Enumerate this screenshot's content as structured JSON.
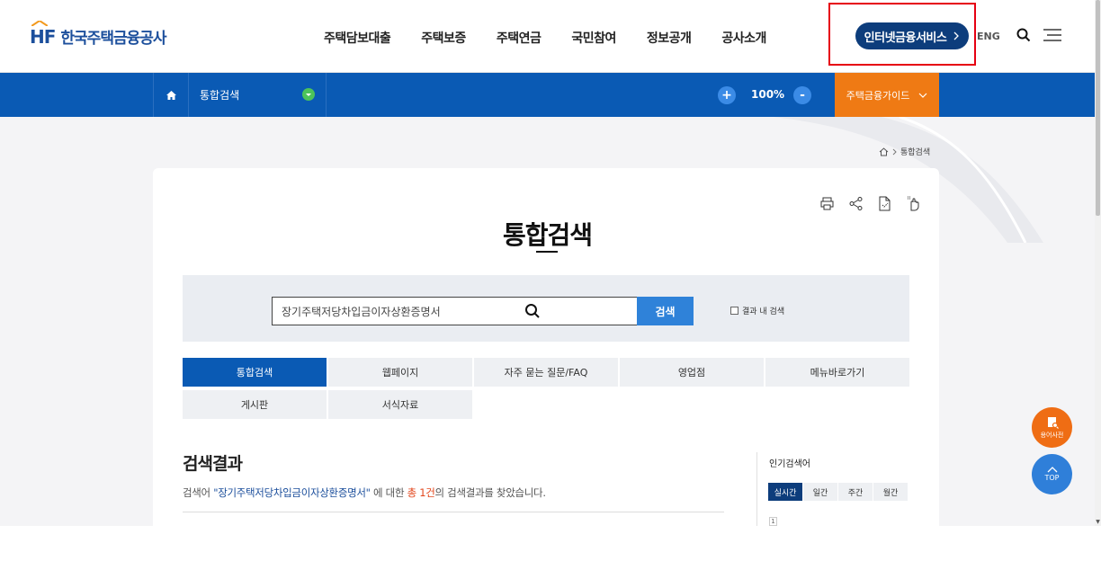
{
  "header": {
    "logo_mark": "HF",
    "logo_text": "한국주택금융공사",
    "gnb": [
      "주택담보대출",
      "주택보증",
      "주택연금",
      "국민참여",
      "정보공개",
      "공사소개"
    ],
    "internet_service": "인터넷금융서비스",
    "eng": "ENG"
  },
  "subbar": {
    "location": "통합검색",
    "zoom": "100%",
    "zoom_plus": "+",
    "zoom_minus": "-",
    "guide": "주택금융가이드"
  },
  "breadcrumb": {
    "current": "통합검색"
  },
  "page": {
    "title": "통합검색"
  },
  "search": {
    "value": "장기주택저당차입금이자상환증명서",
    "button": "검색",
    "inner_search": "결과 내 검색"
  },
  "tabs": [
    {
      "label": "통합검색",
      "active": true
    },
    {
      "label": "웹페이지"
    },
    {
      "label": "자주 묻는 질문/FAQ"
    },
    {
      "label": "영업점"
    },
    {
      "label": "메뉴바로가기"
    },
    {
      "label": "게시판"
    },
    {
      "label": "서식자료"
    }
  ],
  "results": {
    "title": "검색결과",
    "desc_prefix": "검색어 ",
    "query_quoted": "\"장기주택저당차입금이자상환증명서\"",
    "desc_mid": " 에 대한 ",
    "count": "총 1건",
    "desc_suffix": "의 검색결과를 찾았습니다."
  },
  "popular": {
    "title": "인기검색어",
    "tabs": [
      "실시간",
      "일간",
      "주간",
      "월간"
    ],
    "first_rank": "1"
  },
  "fabs": {
    "dict": "용어사전",
    "top": "TOP"
  },
  "colors": {
    "primary": "#0a5ab4",
    "navy": "#0d3d7c",
    "orange": "#ef7a14",
    "highlight": "#e60012"
  }
}
